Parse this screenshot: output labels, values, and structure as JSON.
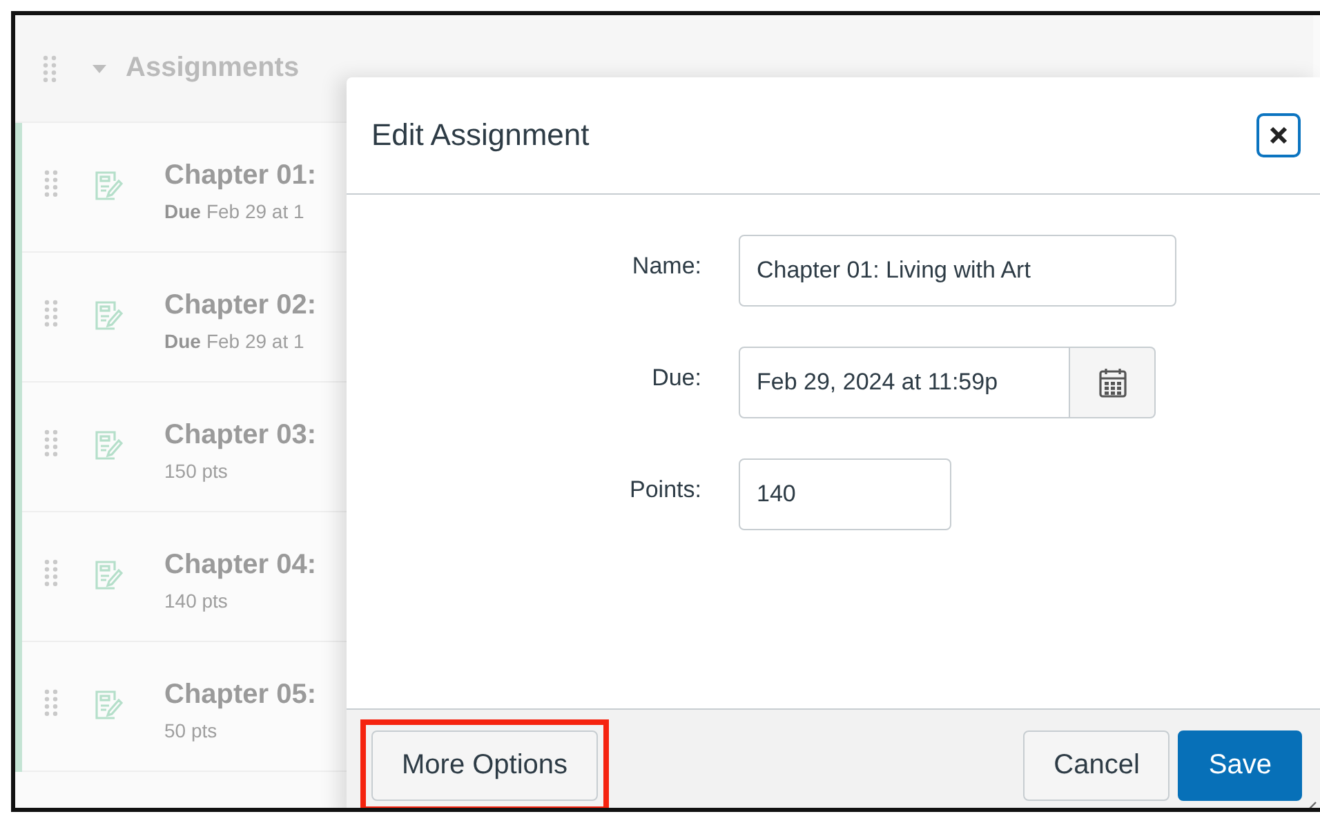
{
  "module": {
    "title": "Assignments",
    "expanded": true,
    "items": [
      {
        "title": "Chapter 01:",
        "due_label": "Due",
        "due_date": "Feb 29 at 1"
      },
      {
        "title": "Chapter 02:",
        "due_label": "Due",
        "due_date": "Feb 29 at 1"
      },
      {
        "title": "Chapter 03:",
        "points": "150 pts"
      },
      {
        "title": "Chapter 04:",
        "points": "140 pts"
      },
      {
        "title": "Chapter 05:",
        "points": "50 pts"
      }
    ]
  },
  "dialog": {
    "title": "Edit Assignment",
    "fields": [
      {
        "kind": "text",
        "label": "Name:",
        "value": "Chapter 01: Living with Art"
      },
      {
        "kind": "date",
        "label": "Due:",
        "value": "Feb 29, 2024 at 11:59p"
      },
      {
        "kind": "number",
        "label": "Points:",
        "value": "140"
      }
    ],
    "buttons": [
      {
        "kind": "secondary",
        "label": "More Options",
        "highlighted": true
      },
      {
        "kind": "secondary",
        "label": "Cancel",
        "highlighted": false
      },
      {
        "kind": "primary",
        "label": "Save",
        "highlighted": false
      }
    ]
  }
}
